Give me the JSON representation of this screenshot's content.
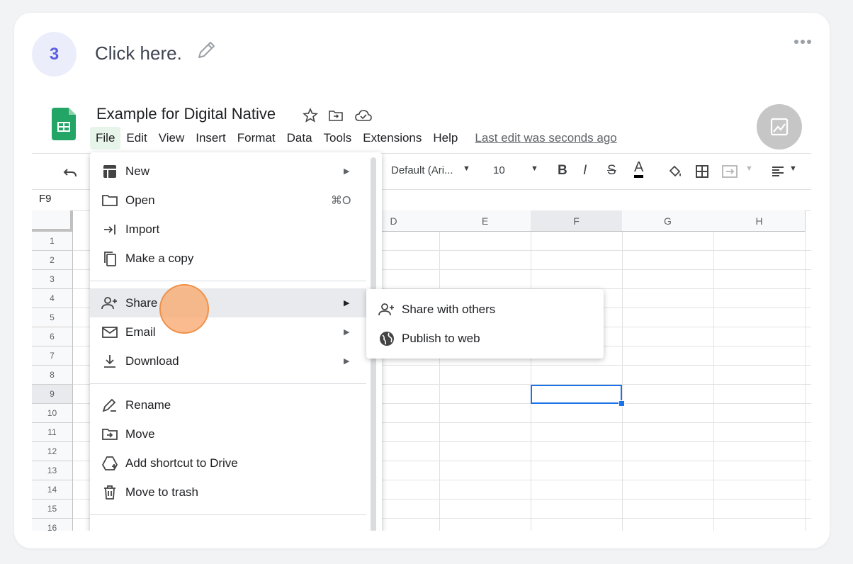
{
  "step": {
    "number": "3",
    "title": "Click here."
  },
  "sheet": {
    "doc_title": "Example for Digital Native",
    "menus": [
      "File",
      "Edit",
      "View",
      "Insert",
      "Format",
      "Data",
      "Tools",
      "Extensions",
      "Help"
    ],
    "last_edit": "Last edit was seconds ago",
    "toolbar": {
      "font": "Default (Ari...",
      "size": "10"
    },
    "name_box": "F9",
    "columns": [
      "D",
      "E",
      "F",
      "G",
      "H"
    ],
    "rows": [
      "1",
      "2",
      "3",
      "4",
      "5",
      "6",
      "7",
      "8",
      "9",
      "10",
      "11",
      "12",
      "13",
      "14",
      "15",
      "16"
    ]
  },
  "file_menu": {
    "new": "New",
    "open": "Open",
    "open_shortcut": "⌘O",
    "import": "Import",
    "make_copy": "Make a copy",
    "share": "Share",
    "email": "Email",
    "download": "Download",
    "rename": "Rename",
    "move": "Move",
    "add_shortcut": "Add shortcut to Drive",
    "move_to_trash": "Move to trash"
  },
  "share_submenu": {
    "share_with_others": "Share with others",
    "publish_to_web": "Publish to web"
  },
  "colors": {
    "accent": "#5b5fe0",
    "sheets_green": "#23a566",
    "selection": "#1a73e8",
    "click": "#f8a96e"
  }
}
